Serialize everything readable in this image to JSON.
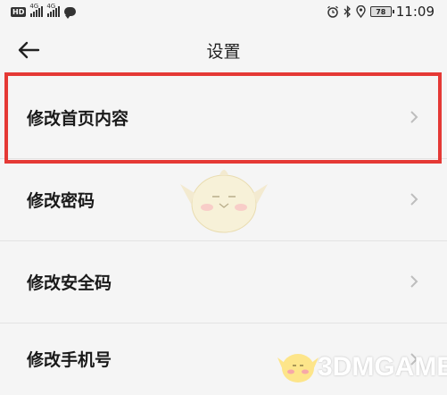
{
  "status_bar": {
    "hd_badge": "HD",
    "signal_1_tag": "4G",
    "signal_2_tag": "4G",
    "battery_level": "78",
    "time": "11:09"
  },
  "header": {
    "title": "设置"
  },
  "menu": {
    "items": [
      {
        "label": "修改首页内容"
      },
      {
        "label": "修改密码"
      },
      {
        "label": "修改安全码"
      },
      {
        "label": "修改手机号"
      }
    ]
  },
  "watermark": "3DMGAME",
  "colors": {
    "background": "#f5f5f5",
    "highlight_border": "#e53935",
    "chevron": "#bdbdbd",
    "divider": "#e3e3e3"
  },
  "icons": {
    "back": "arrow-left-icon",
    "chevron": "chevron-right-icon"
  }
}
